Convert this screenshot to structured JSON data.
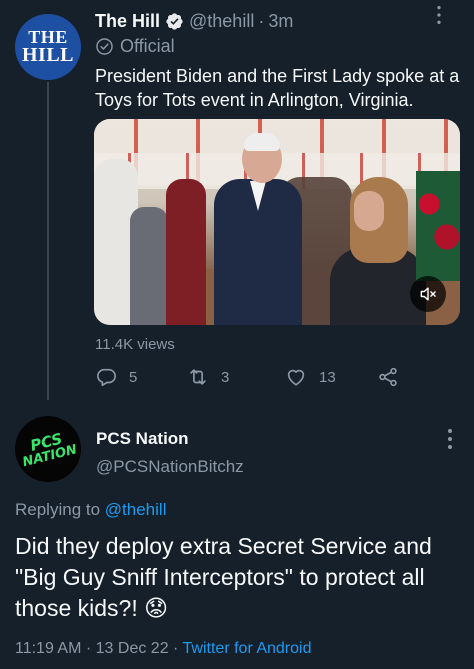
{
  "parent_tweet": {
    "avatar_text": [
      "THE",
      "HILL"
    ],
    "display_name": "The Hill",
    "handle": "@thehill",
    "separator": "·",
    "time": "3m",
    "affiliation_label": "Official",
    "text": "President Biden and the First Lady spoke at a Toys for Tots event in Arlington, Virginia.",
    "views": "11.4K views",
    "stats": {
      "replies": "5",
      "retweets": "3",
      "likes": "13"
    }
  },
  "reply_tweet": {
    "avatar_text": [
      "PCS",
      "NATION"
    ],
    "display_name": "PCS Nation",
    "handle": "@PCSNationBitchz",
    "replying_prefix": "Replying to",
    "replying_to": "@thehill",
    "text": "Did they deploy extra Secret Service and \"Big Guy Sniff Interceptors\" to protect all those kids?! 😟",
    "time": "11:19 AM",
    "date": "13 Dec 22",
    "separator": "·",
    "client": "Twitter for Android"
  },
  "colors": {
    "background": "#15202b",
    "primary_text": "#f7f9f9",
    "secondary_text": "#8b98a5",
    "link": "#1d9bf0",
    "verified_badge": "#1d9bf0",
    "pcs_green": "#3ce36a",
    "hill_blue": "#1d4fa3"
  },
  "icons": {
    "verified": "verified-badge-icon",
    "official": "official-check-icon",
    "reply": "reply-bubble-icon",
    "retweet": "retweet-icon",
    "like": "heart-icon",
    "share": "share-icon",
    "mute": "volume-muted-icon",
    "more": "more-options-icon"
  }
}
